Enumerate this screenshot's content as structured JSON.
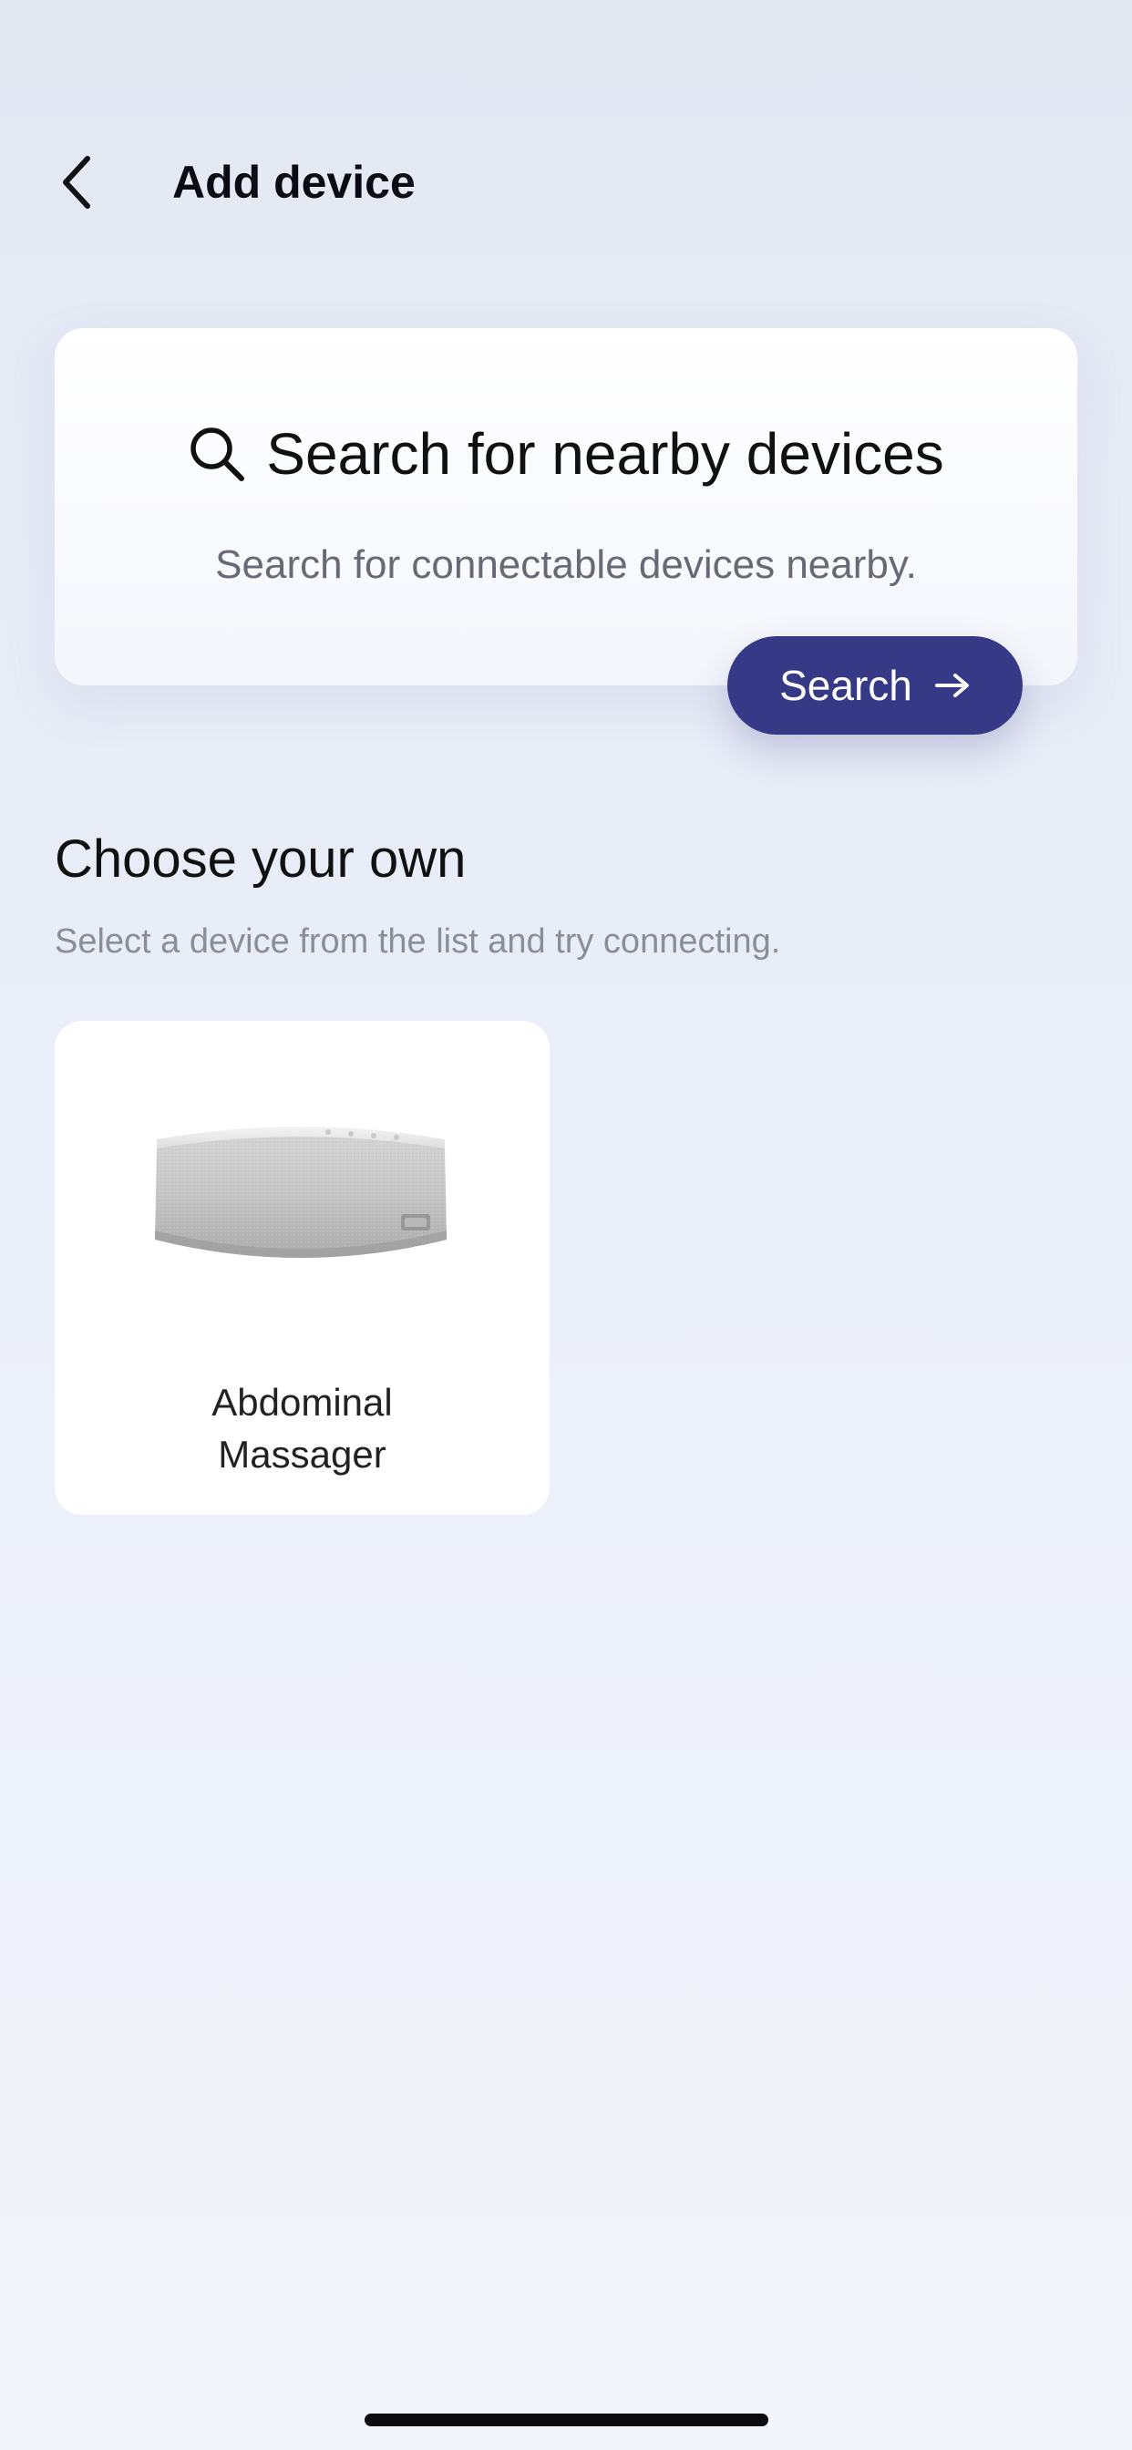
{
  "header": {
    "title": "Add device",
    "back_icon": "chevron-left-icon"
  },
  "search_card": {
    "icon": "search-icon",
    "title": "Search for nearby devices",
    "subtitle": "Search for connectable devices nearby.",
    "button_label": "Search",
    "button_icon": "arrow-right-icon",
    "button_color": "#363985"
  },
  "choose_section": {
    "title": "Choose your own",
    "subtitle": "Select a device from the list and try connecting."
  },
  "devices": [
    {
      "name": "Abdominal Massager",
      "image": "abdominal-massager-image"
    }
  ]
}
